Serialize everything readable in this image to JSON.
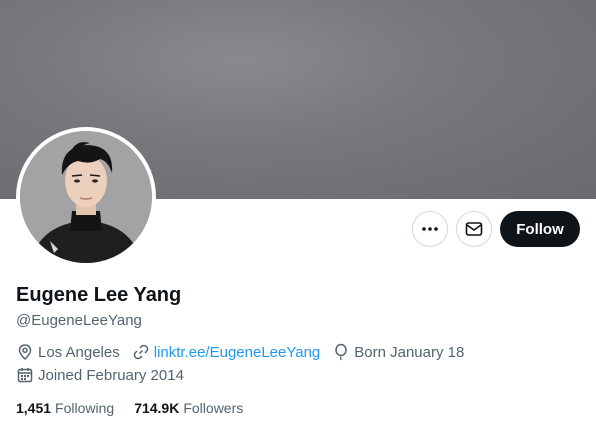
{
  "profile": {
    "display_name": "Eugene Lee Yang",
    "handle": "@EugeneLeeYang",
    "location": "Los Angeles",
    "link": "linktr.ee/EugeneLeeYang",
    "birthday": "Born January 18",
    "joined": "Joined February 2014"
  },
  "actions": {
    "more_icon": "more-horizontal-icon",
    "message_icon": "envelope-icon",
    "follow_label": "Follow"
  },
  "stats": {
    "following_count": "1,451",
    "following_label": "Following",
    "followers_count": "714.9K",
    "followers_label": "Followers"
  },
  "colors": {
    "accent_link": "#1d9bf0",
    "primary_button": "#0f1419",
    "secondary_text": "#536471",
    "banner_gray": "#77777b"
  }
}
